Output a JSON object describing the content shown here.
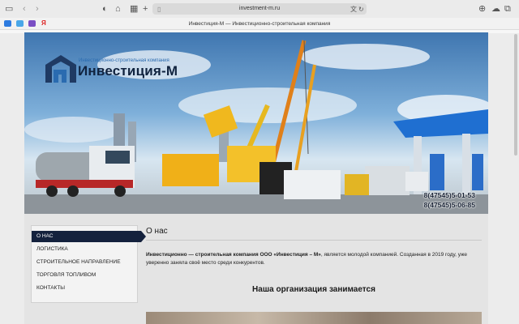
{
  "browser": {
    "url": "investment-m.ru",
    "tab_title": "Инвестиция-М — Инвестиционно-строительная компания"
  },
  "site": {
    "logo_subtitle": "Инвестиционно-строительная компания",
    "logo_name": "Инвестиция-М",
    "phones": [
      "8(47545)5-01-53",
      "8(47545)5-06-85"
    ]
  },
  "nav": {
    "items": [
      "О НАС",
      "ЛОГИСТИКА",
      "СТРОИТЕЛЬНОЕ НАПРАВЛЕНИЕ",
      "ТОРГОВЛЯ ТОПЛИВОМ",
      "КОНТАКТЫ"
    ],
    "active_index": 0
  },
  "content": {
    "title": "О нас",
    "company_bold": "Инвестиционно — строительная компания ООО «Инвестиция – М»",
    "paragraph_rest": ", является молодой компанией. Созданная в 2019 году, уже уверенно заняла своё место среди конкурентов.",
    "subheading": "Наша организация занимается"
  },
  "colors": {
    "nav_active_bg": "#14213d",
    "logo_accent": "#2a6bb0"
  }
}
